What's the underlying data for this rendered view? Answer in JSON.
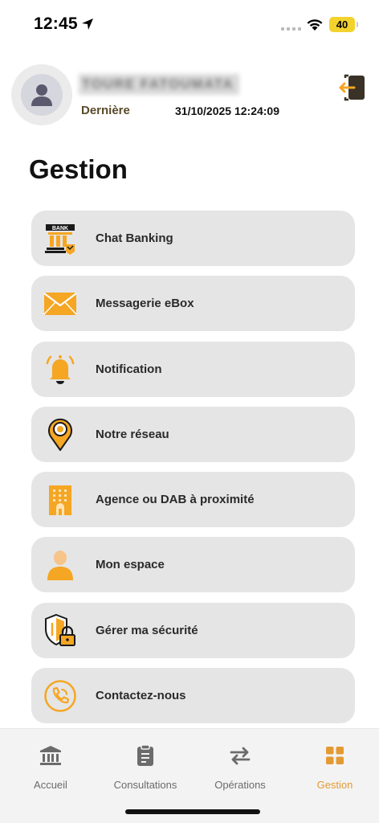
{
  "status_bar": {
    "time": "12:45",
    "battery": "40"
  },
  "header": {
    "user_name": "TOURE FATOUMATA",
    "last_label": "Dernière",
    "last_date": "31/10/2025 12:24:09"
  },
  "page": {
    "title": "Gestion"
  },
  "menu": {
    "items": [
      {
        "label": "Chat Banking",
        "icon": "bank-icon"
      },
      {
        "label": "Messagerie eBox",
        "icon": "envelope-icon"
      },
      {
        "label": "Notification",
        "icon": "bell-icon"
      },
      {
        "label": "Notre réseau",
        "icon": "location-pin-icon"
      },
      {
        "label": "Agence ou DAB à proximité",
        "icon": "building-icon"
      },
      {
        "label": "Mon espace",
        "icon": "person-icon"
      },
      {
        "label": "Gérer ma sécurité",
        "icon": "shield-lock-icon"
      },
      {
        "label": "Contactez-nous",
        "icon": "phone-icon"
      }
    ]
  },
  "bank_icon_text": "BANK",
  "bottom_nav": {
    "items": [
      {
        "label": "Accueil",
        "icon": "bank-building-icon"
      },
      {
        "label": "Consultations",
        "icon": "clipboard-icon"
      },
      {
        "label": "Opérations",
        "icon": "transfer-arrows-icon"
      },
      {
        "label": "Gestion",
        "icon": "grid-icon",
        "active": true
      }
    ]
  },
  "colors": {
    "accent": "#f5a623",
    "active_nav": "#e39a33",
    "card_bg": "#e5e5e5",
    "nav_bg": "#f3f3f3"
  }
}
